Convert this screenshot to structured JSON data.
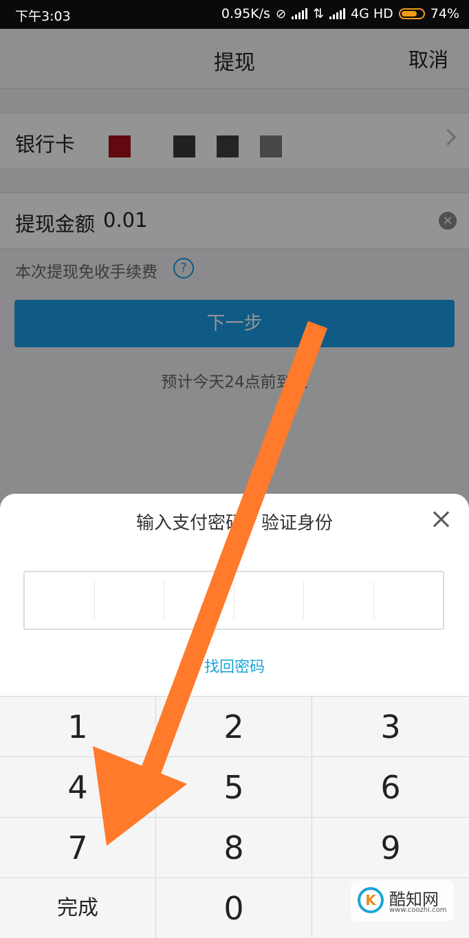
{
  "status": {
    "time": "下午3:03",
    "speed": "0.95K/s",
    "network": "4G HD",
    "battery": "74%",
    "battery_level": 0.74
  },
  "header": {
    "title": "提现",
    "cancel_label": "取消"
  },
  "bank": {
    "label": "银行卡",
    "card_colors": [
      "#a8111a",
      "#3a3a3a",
      "#3f3f3f",
      "#7b7b7b"
    ]
  },
  "amount": {
    "label": "提现金额",
    "value": "0.01"
  },
  "fee_text": "本次提现免收手续费",
  "next_button": "下一步",
  "eta_text": "预计今天24点前到账",
  "sheet": {
    "title": "输入支付密码，验证身份",
    "forgot_label": "找回密码",
    "keys": [
      "1",
      "2",
      "3",
      "4",
      "5",
      "6",
      "7",
      "8",
      "9",
      "完成",
      "0",
      ""
    ]
  },
  "colors": {
    "accent": "#1c9de6",
    "arrow": "#ff7a2a"
  },
  "watermark": {
    "name": "酷知网",
    "url": "www.coozhi.com"
  }
}
